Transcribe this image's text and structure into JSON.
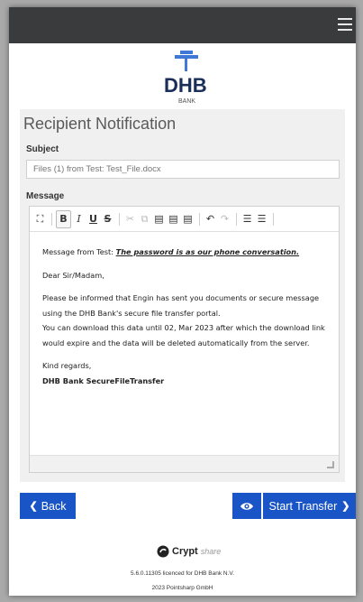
{
  "logo": {
    "text": "DHB",
    "subtext": "BANK",
    "color": "#1a2e5a",
    "accent": "#3f79d5"
  },
  "page": {
    "title": "Recipient Notification"
  },
  "subject": {
    "label": "Subject",
    "placeholder": "Files (1) from Test: Test_File.docx"
  },
  "message": {
    "label": "Message",
    "toolbar": [
      "maximize-icon",
      "bold-icon",
      "italic-icon",
      "underline-icon",
      "strikethrough-icon",
      "cut-icon",
      "copy-icon",
      "paste-icon",
      "paste-text-icon",
      "paste-word-icon",
      "undo-icon",
      "redo-icon",
      "numbered-list-icon",
      "bulleted-list-icon"
    ],
    "intro": "Message from Test: ",
    "password_note": "The password is as our phone conversation.",
    "greeting": "Dear Sir/Madam,",
    "para1_line1": "Please be informed that Engin has sent you documents or secure message",
    "para1_line2": "using the DHB Bank's secure file transfer portal.",
    "para2_line1": "You can download this data until 02, Mar 2023 after which the download link",
    "para2_line2": "would expire and the data will be deleted automatically from the server.",
    "closing": "Kind regards,",
    "signature": "DHB Bank SecureFileTransfer"
  },
  "buttons": {
    "back": "Back",
    "start": "Start Transfer"
  },
  "colors": {
    "primary": "#1a55c8",
    "topbar": "#3a3b3c"
  },
  "footer": {
    "brand_main": "Crypt",
    "brand_sub": "share",
    "version": "5.6.0.11305 licenced for DHB Bank N.V.",
    "copyright": "2023 Pointsharp GmbH"
  }
}
